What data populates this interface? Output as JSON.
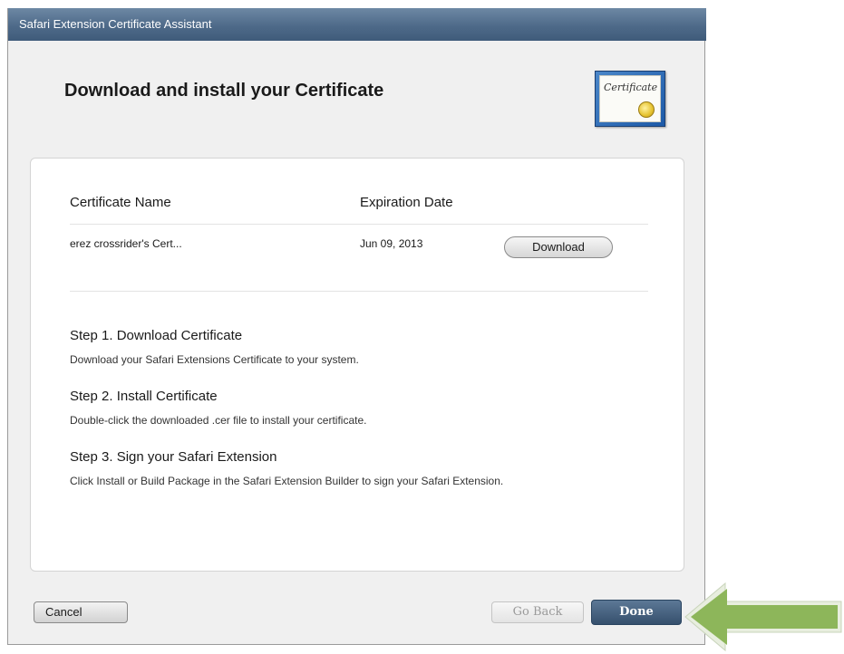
{
  "window": {
    "title": "Safari Extension Certificate Assistant"
  },
  "header": {
    "title": "Download and install your Certificate",
    "icon": "certificate-icon",
    "icon_text": "Certificate"
  },
  "table": {
    "columns": [
      "Certificate Name",
      "Expiration Date"
    ],
    "rows": [
      {
        "name": "erez crossrider's Cert...",
        "expiration": "Jun 09, 2013",
        "action_label": "Download"
      }
    ]
  },
  "steps": [
    {
      "title": "Step 1. Download Certificate",
      "description": "Download your Safari Extensions Certificate to your system."
    },
    {
      "title": "Step 2. Install Certificate",
      "description": "Double-click the downloaded .cer file to install your certificate."
    },
    {
      "title": "Step 3. Sign your Safari Extension",
      "description": "Click Install or Build Package in the Safari Extension Builder to sign your Safari Extension."
    }
  ],
  "footer": {
    "cancel_label": "Cancel",
    "go_back_label": "Go Back",
    "done_label": "Done"
  },
  "colors": {
    "titlebar": "#4e6a89",
    "done_button": "#36506d",
    "arrow": "#8db65a"
  }
}
